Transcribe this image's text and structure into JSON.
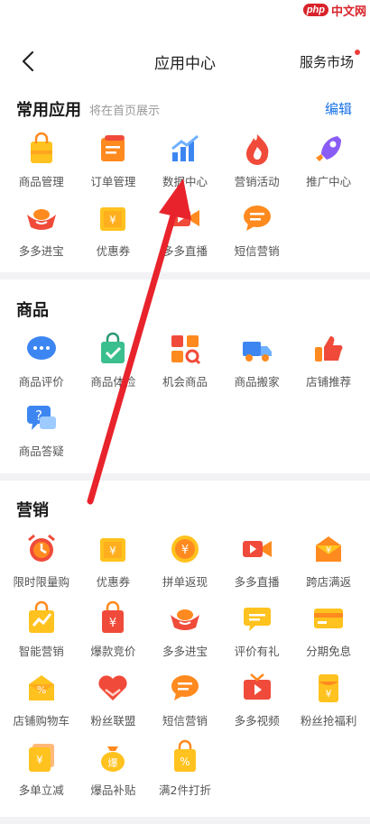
{
  "watermark": {
    "logo": "php",
    "text": "中文网"
  },
  "header": {
    "title": "应用中心",
    "service_market": "服务市场"
  },
  "common": {
    "title": "常用应用",
    "subtitle": "将在首页展示",
    "edit": "编辑",
    "items": [
      {
        "label": "商品管理",
        "icon": "shopping-bag-icon"
      },
      {
        "label": "订单管理",
        "icon": "order-scroll-icon"
      },
      {
        "label": "数据中心",
        "icon": "bar-chart-icon"
      },
      {
        "label": "营销活动",
        "icon": "flame-icon"
      },
      {
        "label": "推广中心",
        "icon": "rocket-icon"
      },
      {
        "label": "多多进宝",
        "icon": "ingot-icon"
      },
      {
        "label": "优惠券",
        "icon": "coupon-icon"
      },
      {
        "label": "多多直播",
        "icon": "video-camera-icon"
      },
      {
        "label": "短信营销",
        "icon": "sms-bubble-icon"
      }
    ]
  },
  "goods": {
    "title": "商品",
    "items": [
      {
        "label": "商品评价",
        "icon": "comment-bubble-icon"
      },
      {
        "label": "商品体检",
        "icon": "checkup-bag-icon"
      },
      {
        "label": "机会商品",
        "icon": "opportunity-grid-icon"
      },
      {
        "label": "商品搬家",
        "icon": "truck-icon"
      },
      {
        "label": "店铺推荐",
        "icon": "thumbs-up-icon"
      },
      {
        "label": "商品答疑",
        "icon": "question-bubble-icon"
      }
    ]
  },
  "marketing": {
    "title": "营销",
    "items": [
      {
        "label": "限时限量购",
        "icon": "alarm-clock-icon"
      },
      {
        "label": "优惠券",
        "icon": "coupon-icon"
      },
      {
        "label": "拼单返现",
        "icon": "cashback-coin-icon"
      },
      {
        "label": "多多直播",
        "icon": "video-camera-icon"
      },
      {
        "label": "跨店满返",
        "icon": "cross-store-envelope-icon"
      },
      {
        "label": "智能营销",
        "icon": "trend-bag-icon"
      },
      {
        "label": "爆款竞价",
        "icon": "bid-bag-icon"
      },
      {
        "label": "多多进宝",
        "icon": "ingot-icon"
      },
      {
        "label": "评价有礼",
        "icon": "review-gift-icon"
      },
      {
        "label": "分期免息",
        "icon": "credit-card-icon"
      },
      {
        "label": "店铺购物车",
        "icon": "discount-envelope-icon"
      },
      {
        "label": "粉丝联盟",
        "icon": "heart-hands-icon"
      },
      {
        "label": "短信营销",
        "icon": "sms-bubble-icon"
      },
      {
        "label": "多多视频",
        "icon": "tv-play-icon"
      },
      {
        "label": "粉丝抢福利",
        "icon": "red-envelope-icon"
      },
      {
        "label": "多单立减",
        "icon": "stacked-coupon-icon"
      },
      {
        "label": "爆品补贴",
        "icon": "money-bag-icon"
      },
      {
        "label": "满2件打折",
        "icon": "discount-bag-icon"
      }
    ]
  },
  "colors": {
    "orange": "#ff8a1f",
    "yellow": "#ffc21e",
    "red": "#f04b3a",
    "blue": "#3d86f2",
    "accent_link": "#1a72e8",
    "annotation_arrow": "#e8232c"
  }
}
